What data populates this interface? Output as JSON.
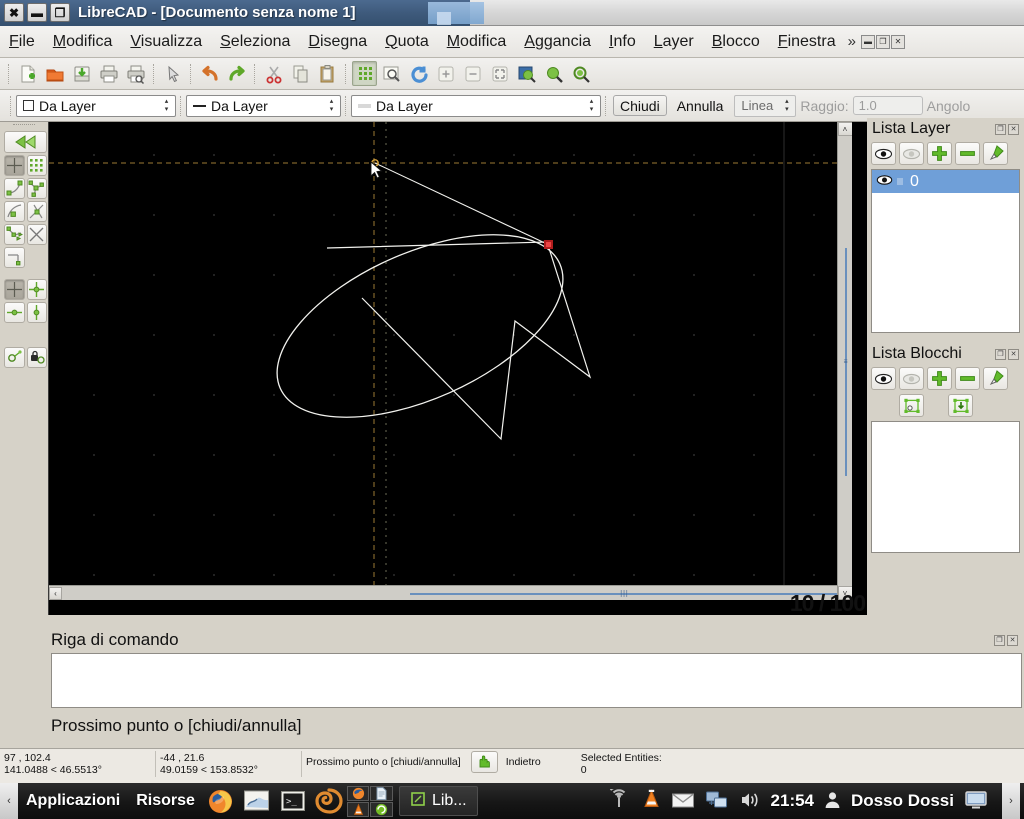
{
  "window": {
    "title": "LibreCAD - [Documento senza nome 1]",
    "controls": [
      {
        "name": "close-button",
        "glyph": "✖"
      },
      {
        "name": "minimize-button",
        "glyph": "▬"
      },
      {
        "name": "maximize-button",
        "glyph": "❐"
      }
    ],
    "titlebar_color": "#3e5a7c"
  },
  "menubar": {
    "items": [
      {
        "label": "File",
        "mnemonic": "F"
      },
      {
        "label": "Modifica",
        "mnemonic": "M"
      },
      {
        "label": "Visualizza",
        "mnemonic": "V"
      },
      {
        "label": "Seleziona",
        "mnemonic": "S"
      },
      {
        "label": "Disegna",
        "mnemonic": "D"
      },
      {
        "label": "Quota",
        "mnemonic": "Q"
      },
      {
        "label": "Modifica",
        "mnemonic": "M"
      },
      {
        "label": "Aggancia",
        "mnemonic": "A"
      },
      {
        "label": "Info",
        "mnemonic": "I"
      },
      {
        "label": "Layer",
        "mnemonic": "L"
      },
      {
        "label": "Blocco",
        "mnemonic": "B"
      },
      {
        "label": "Finestra",
        "mnemonic": "F"
      }
    ],
    "overflow": "»",
    "mdi_buttons": [
      "minimize-mdi",
      "restore-mdi",
      "close-mdi"
    ]
  },
  "toolbar": {
    "buttons": [
      {
        "name": "new-file-icon"
      },
      {
        "name": "open-file-icon"
      },
      {
        "name": "save-file-icon"
      },
      {
        "name": "print-icon"
      },
      {
        "name": "print-preview-icon"
      },
      {
        "name": "select-pointer-icon"
      },
      {
        "name": "undo-icon"
      },
      {
        "name": "redo-icon"
      },
      {
        "name": "cut-icon"
      },
      {
        "name": "copy-icon"
      },
      {
        "name": "paste-icon"
      },
      {
        "name": "grid-toggle-icon"
      },
      {
        "name": "zoom-window-icon"
      },
      {
        "name": "redraw-icon"
      },
      {
        "name": "zoom-in-icon"
      },
      {
        "name": "zoom-out-icon"
      },
      {
        "name": "zoom-auto-icon"
      },
      {
        "name": "zoom-previous-icon"
      },
      {
        "name": "zoom-selection-icon"
      },
      {
        "name": "zoom-pan-icon"
      }
    ]
  },
  "options_bar": {
    "pen_color": "Da Layer",
    "pen_width": "Da Layer",
    "pen_linetype": "Da Layer",
    "close_label": "Chiudi",
    "undo_label": "Annulla",
    "mode_value": "Linea",
    "radius_label": "Raggio:",
    "radius_value": "1.0",
    "angle_label": "Angolo"
  },
  "left_dock": {
    "back_button": "back-arrow-icon",
    "snap_buttons": [
      "snap-free-icon",
      "snap-grid-icon",
      "snap-endpoint-icon",
      "snap-on-entity-icon",
      "snap-center-icon",
      "snap-middle-icon",
      "snap-distance-icon",
      "snap-intersection-icon",
      "snap-perpendicular-icon",
      "restrict-nothing-icon",
      "restrict-orthogonal-icon",
      "restrict-horizontal-icon",
      "restrict-vertical-icon",
      "relative-zero-icon",
      "lock-relative-zero-icon"
    ]
  },
  "canvas": {
    "background": "#000000",
    "grid_color": "#3a3a3a",
    "entity_color": "#ffffff",
    "crosshair_color": "#a07a33",
    "marker_color": "#cc2222",
    "zoom_overlay": "10 / 100"
  },
  "layer_panel": {
    "title": "Lista Layer",
    "buttons": [
      "show-all-layers-icon",
      "hide-all-layers-icon",
      "add-layer-icon",
      "remove-layer-icon",
      "edit-layer-icon"
    ],
    "panel_buttons": [
      "float-panel",
      "close-panel"
    ],
    "layers": [
      {
        "name": "0",
        "visible": true,
        "locked": false,
        "selected": true
      }
    ]
  },
  "block_panel": {
    "title": "Lista Blocchi",
    "buttons": [
      "show-all-blocks-icon",
      "hide-all-blocks-icon",
      "add-block-icon",
      "remove-block-icon",
      "edit-block-icon",
      "insert-block-icon",
      "create-block-icon"
    ],
    "panel_buttons": [
      "float-panel",
      "close-panel"
    ],
    "blocks": []
  },
  "command_line": {
    "title": "Riga di comando",
    "panel_buttons": [
      "float-panel",
      "close-panel"
    ],
    "history": "",
    "prompt": "Prossimo punto o [chiudi/annulla]",
    "input_value": ""
  },
  "status_bar": {
    "abs_coord": "97 , 102.4",
    "abs_polar": "141.0488 < 46.5513°",
    "rel_coord": "-44 , 21.6",
    "rel_polar": "49.0159 < 153.8532°",
    "prompt": "Prossimo punto o [chiudi/annulla]",
    "back_button_icon": "hand-back-icon",
    "back_label": "Indietro",
    "selected_label": "Selected Entities:",
    "selected_count": "0"
  },
  "taskbar": {
    "left_arrow": "‹",
    "menus": [
      "Applicazioni",
      "Risorse"
    ],
    "launchers": [
      "firefox-icon",
      "image-viewer-icon",
      "terminal-icon",
      "shell-snail-icon"
    ],
    "mini_grid": [
      "firefox-small-icon",
      "document-small-icon",
      "vlc-small-icon",
      "opensuse-small-icon"
    ],
    "task_button": {
      "icon": "librecad-icon",
      "label": "Lib..."
    },
    "tray": [
      "wifi-icon",
      "vlc-cone-icon",
      "mail-icon",
      "network-icon",
      "volume-icon"
    ],
    "clock": "21:54",
    "user_icon": "user-icon",
    "username": "Dosso Dossi",
    "display_icon": "display-icon",
    "right_arrow": "›"
  }
}
